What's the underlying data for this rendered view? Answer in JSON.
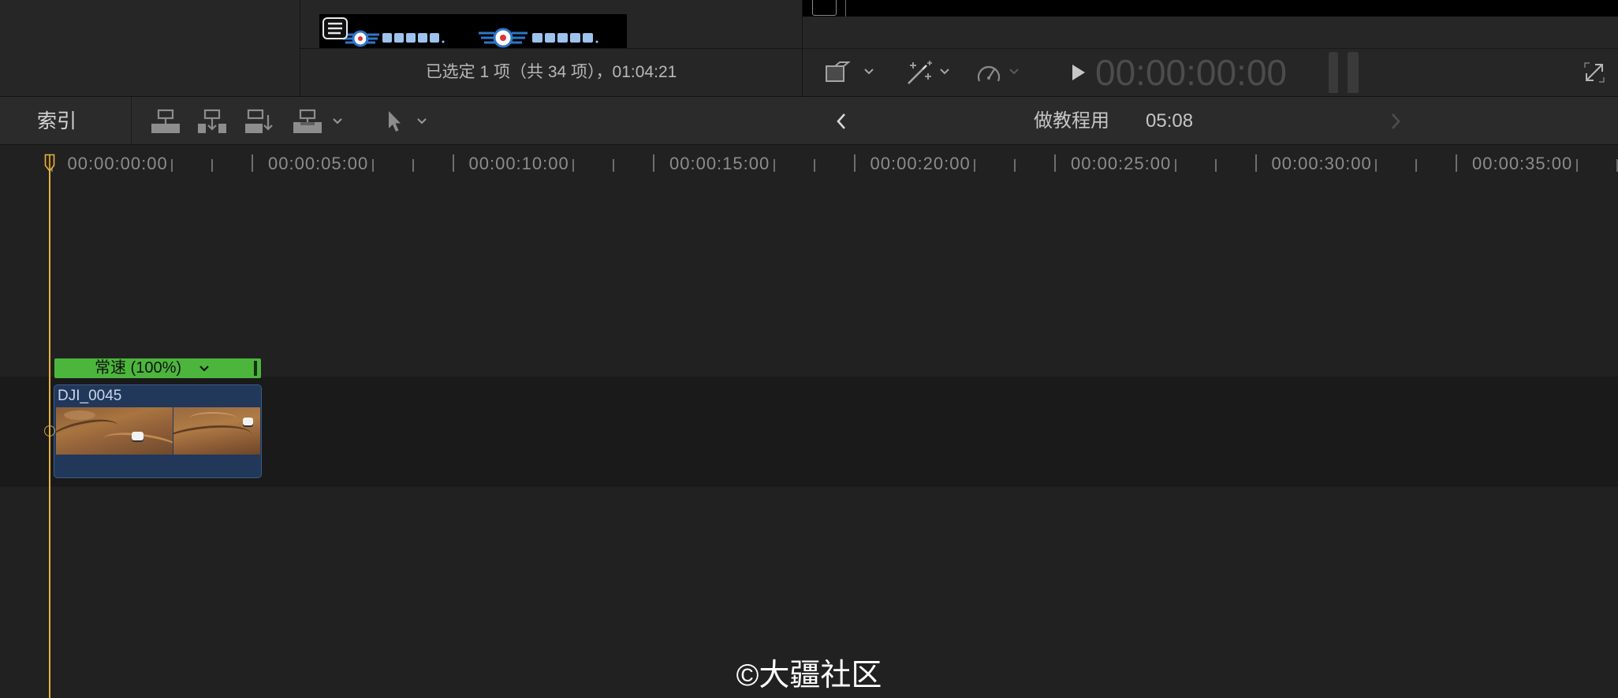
{
  "browser": {
    "status_text": "已选定 1 项（共 34 项），01:04:21",
    "filmstrip_icons": [
      "clip-stack-icon",
      "logo-emblem",
      "logo-emblem"
    ]
  },
  "viewer": {
    "timecode": "00:00:00:00",
    "toolbar_icons": [
      "transform-icon",
      "chevron-down-icon",
      "enhance-wand-icon",
      "chevron-down-icon",
      "retime-gauge-icon",
      "chevron-down-icon",
      "play-icon",
      "audio-meter-icon",
      "fullscreen-icon"
    ]
  },
  "timeline_toolbar": {
    "index_label": "索引",
    "edit_icons": [
      "connect-clip-icon",
      "insert-clip-icon",
      "append-clip-icon",
      "overwrite-clip-icon",
      "chevron-down-icon",
      "select-arrow-icon",
      "chevron-down-icon"
    ],
    "nav_icons": [
      "chevron-left-icon",
      "chevron-right-icon"
    ],
    "project_name": "做教程用",
    "project_duration": "05:08"
  },
  "ruler": {
    "labels": [
      "00:00:00:00",
      "00:00:05:00",
      "00:00:10:00",
      "00:00:15:00",
      "00:00:20:00",
      "00:00:25:00",
      "00:00:30:00",
      "00:00:35:00"
    ]
  },
  "timeline": {
    "clip": {
      "name": "DJI_0045",
      "retime_label": "常速 (100%)"
    }
  },
  "watermark": "©大疆社区",
  "colors": {
    "playhead": "#e6b23e",
    "retime_bar": "#4cb63c",
    "clip_fill": "#21385b",
    "clip_border": "#3a5c86",
    "timeline_bg": "#212121",
    "storyline_band": "#1a1a1a",
    "panel_bg": "#262626",
    "toolbar_bg": "#2b2b2b"
  }
}
